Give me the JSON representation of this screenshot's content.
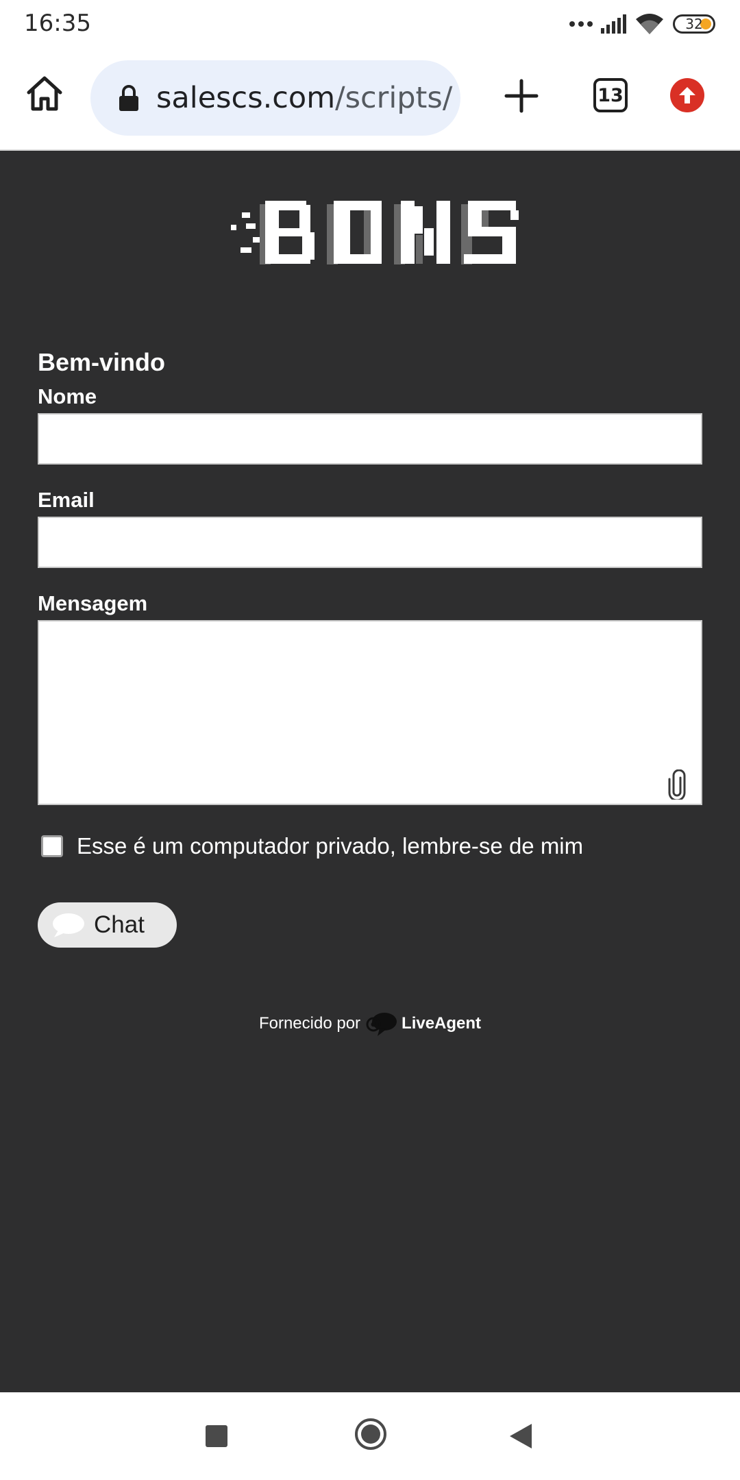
{
  "status_bar": {
    "time": "16:35",
    "battery_level": "32",
    "battery_accent": "#f5a623"
  },
  "browser": {
    "url_host": "salescs.com",
    "url_path": "/scripts/",
    "tab_count": "13",
    "icons": {
      "home": "home-icon",
      "lock": "lock-icon",
      "new_tab": "plus-icon",
      "tabs": "tab-switcher-icon",
      "update": "arrow-up-icon"
    },
    "update_color": "#d93025"
  },
  "page": {
    "background": "#2e2e2f",
    "logo_text": "BONS",
    "form": {
      "title": "Bem-vindo",
      "name_label": "Nome",
      "name_value": "",
      "email_label": "Email",
      "email_value": "",
      "message_label": "Mensagem",
      "message_value": "",
      "remember_label": "Esse é um computador privado, lembre-se de mim",
      "remember_checked": false,
      "chat_button_label": "Chat"
    },
    "footer": {
      "powered_prefix": "Fornecido por",
      "brand": "LiveAgent"
    }
  },
  "nav_bar": {
    "icons": [
      "recents-square-icon",
      "home-circle-icon",
      "back-triangle-icon"
    ]
  }
}
